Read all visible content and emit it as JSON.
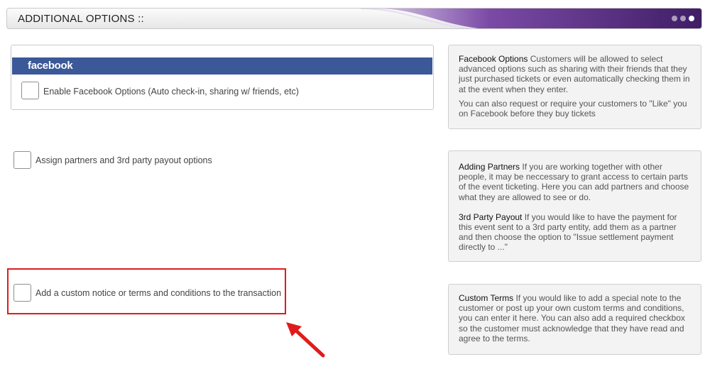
{
  "header": {
    "title": "ADDITIONAL OPTIONS ::",
    "accent_color": "#5b2a86"
  },
  "facebook": {
    "logo_text": "facebook",
    "brand_color": "#3b5998",
    "option_label": "Enable Facebook Options (Auto check-in, sharing w/ friends, etc)"
  },
  "partners": {
    "option_label": "Assign partners and 3rd party payout options"
  },
  "custom_terms": {
    "option_label": "Add a custom notice or terms and conditions to the transaction"
  },
  "help": {
    "facebook": {
      "term": "Facebook Options",
      "text": " Customers will be allowed to select advanced options such as sharing with their friends that they just purchased tickets or even automatically checking them in at the event when they enter.",
      "text2": "You can also request or require your customers to \"Like\" you on Facebook before they buy tickets"
    },
    "partners": {
      "term": "Adding Partners",
      "text": " If you are working together with other people, it may be neccessary to grant access to certain parts of the event ticketing. Here you can add partners and choose what they are allowed to see or do.",
      "term2": "3rd Party Payout",
      "text2": " If you would like to have the payment for this event sent to a 3rd party entity, add them as a partner and then choose the option to \"Issue settlement payment directly to ...\""
    },
    "custom_terms": {
      "term": "Custom Terms",
      "text": " If you would like to add a special note to the customer or post up your own custom terms and conditions, you can enter it here. You can also add a required checkbox so the customer must acknowledge that they have read and agree to the terms."
    }
  },
  "annotation": {
    "highlight_color": "#e01b1b"
  }
}
